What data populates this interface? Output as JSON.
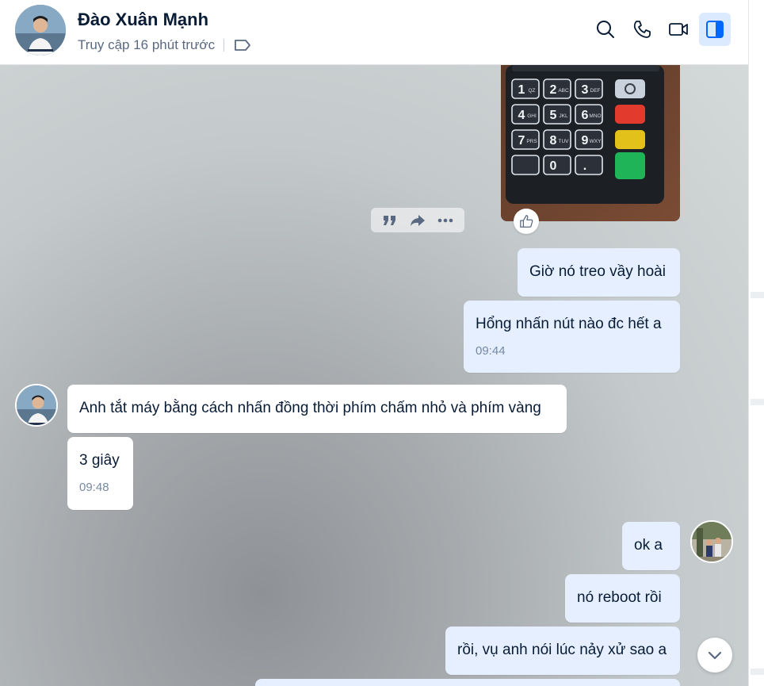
{
  "header": {
    "name": "Đào Xuân Mạnh",
    "status": "Truy cập 16 phút trước",
    "actions": [
      "search-icon",
      "phone-icon",
      "video-icon",
      "sidebar-toggle-icon"
    ]
  },
  "messages": {
    "m1": {
      "text": "Giờ nó treo vầy hoài"
    },
    "m2": {
      "text": "Hổng nhấn nút nào đc hết a",
      "time": "09:44"
    },
    "m3": {
      "text": "Anh tắt máy bằng cách nhấn đồng thời phím chấm nhỏ và phím vàng"
    },
    "m4": {
      "text": "3 giây",
      "time": "09:48"
    },
    "m5": {
      "text": "ok a"
    },
    "m6": {
      "text": "nó reboot rồi"
    },
    "m7": {
      "text": "rồi, vụ anh nói lúc nảy xử sao a"
    }
  },
  "keypad": {
    "keys": [
      "1",
      "2",
      "3",
      "4",
      "5",
      "6",
      "7",
      "8",
      "9",
      "0",
      "."
    ],
    "sub": [
      "QZ",
      "ABC",
      "DEF",
      "GHI",
      "JKL",
      "MNO",
      "PRS",
      "TUV",
      "WXY"
    ]
  },
  "colors": {
    "my_bubble": "#e5efff",
    "their_bubble": "#ffffff",
    "accent": "#0068ff",
    "text": "#081c36",
    "time": "#7589a3"
  }
}
